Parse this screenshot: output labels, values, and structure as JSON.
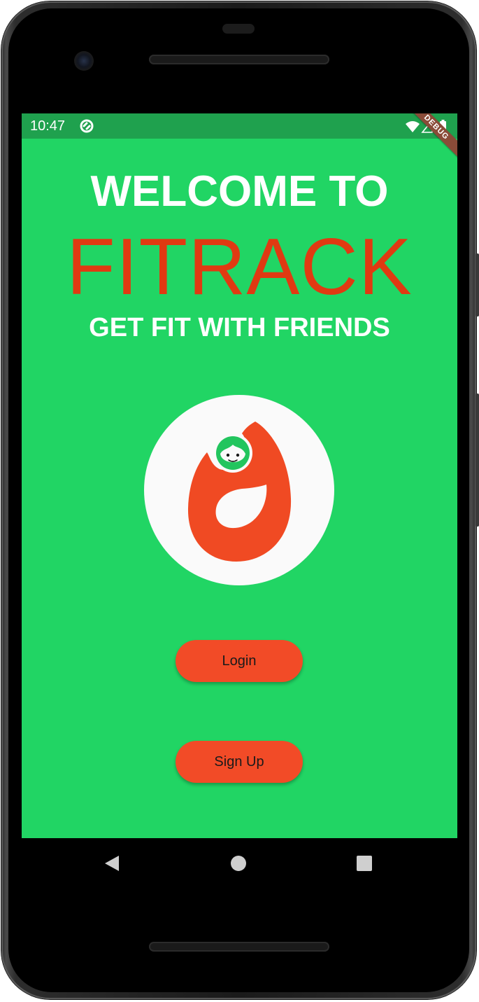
{
  "status_bar": {
    "time": "10:47",
    "debug_banner": "DEBUG"
  },
  "welcome_screen": {
    "heading": "WELCOME TO",
    "brand_name": "FITRACK",
    "tagline": "GET FIT WITH FRIENDS",
    "login_label": "Login",
    "signup_label": "Sign Up"
  },
  "nav_bar": {
    "back_icon": "back-triangle",
    "home_icon": "home-circle",
    "recents_icon": "recents-square"
  },
  "colors": {
    "screen_background": "#21d564",
    "status_bar_background": "#1fa14e",
    "brand_text": "#e03a12",
    "button_background": "#f24b27",
    "logo_circle": "#fafafa",
    "logo_flame": "#f04a23"
  }
}
